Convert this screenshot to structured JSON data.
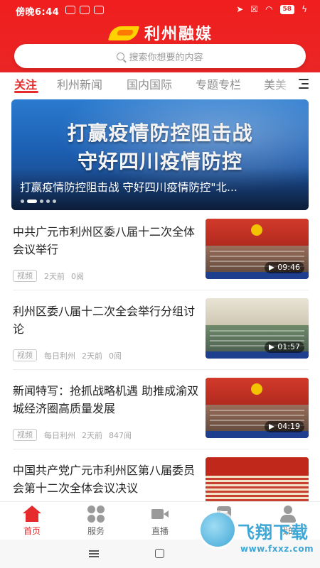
{
  "status_bar": {
    "time": "傍晚6:44",
    "battery": "58",
    "icons": [
      "telegram-icon",
      "app-icon",
      "app-icon",
      "location-icon",
      "sim-icon",
      "wifi-icon",
      "battery-icon",
      "charging-icon"
    ]
  },
  "header": {
    "app_name": "利州融媒",
    "brand_color": "#e52b2b",
    "search_placeholder": "搜索你想要的内容"
  },
  "tabs": [
    {
      "label": "关注",
      "active": true
    },
    {
      "label": "利州新闻",
      "active": false
    },
    {
      "label": "国内国际",
      "active": false
    },
    {
      "label": "专题专栏",
      "active": false
    },
    {
      "label": "美美",
      "active": false
    }
  ],
  "banner": {
    "headline_line1": "打赢疫情防控阻击战",
    "headline_line2": "守好四川疫情防控",
    "caption": "打赢疫情防控阻击战 守好四川疫情防控\"北...",
    "slide_count": 5,
    "active_slide": 1
  },
  "news": [
    {
      "title": "中共广元市利州区委八届十二次全体会议举行",
      "tag": "视频",
      "meta": [
        "2天前",
        "0阅"
      ],
      "duration": "09:46"
    },
    {
      "title": "利州区委八届十二次全会举行分组讨论",
      "tag": "视频",
      "meta": [
        "每日利州",
        "2天前",
        "0阅"
      ],
      "duration": "01:57"
    },
    {
      "title": "新闻特写：抢抓战略机遇 助推成渝双城经济圈高质量发展",
      "tag": "视频",
      "meta": [
        "每日利州",
        "2天前",
        "847阅"
      ],
      "duration": "04:19"
    },
    {
      "title": "中国共产党广元市利州区第八届委员会第十二次全体会议决议",
      "tag": "",
      "meta": [],
      "duration": ""
    }
  ],
  "bottom_nav": [
    {
      "label": "首页",
      "active": true
    },
    {
      "label": "服务",
      "active": false
    },
    {
      "label": "直播",
      "active": false
    },
    {
      "label": "图库",
      "active": false
    },
    {
      "label": "我的",
      "active": false
    }
  ],
  "watermark": {
    "title": "飞翔下载",
    "url": "www.fxxz.com"
  }
}
